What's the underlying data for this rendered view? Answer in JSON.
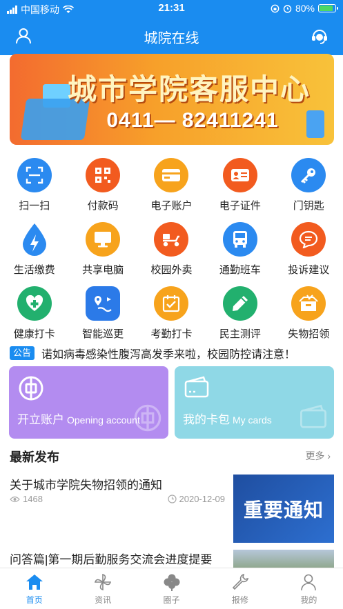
{
  "status_bar": {
    "carrier": "中国移动",
    "time": "21:31",
    "battery": "80%"
  },
  "header": {
    "title": "城院在线"
  },
  "banner": {
    "title": "城市学院客服中心",
    "phone": "0411— 82411241"
  },
  "grid": [
    [
      {
        "label": "扫一扫",
        "icon": "scan-icon",
        "color": "#2b8af0"
      },
      {
        "label": "付款码",
        "icon": "qrcode-icon",
        "color": "#f25b1f"
      },
      {
        "label": "电子账户",
        "icon": "card-icon",
        "color": "#f7a31c"
      },
      {
        "label": "电子证件",
        "icon": "id-card-icon",
        "color": "#f25b1f"
      },
      {
        "label": "门钥匙",
        "icon": "key-icon",
        "color": "#2b8af0"
      }
    ],
    [
      {
        "label": "生活缴费",
        "icon": "water-drop-icon",
        "color": "#2b8af0"
      },
      {
        "label": "共享电脑",
        "icon": "monitor-icon",
        "color": "#f7a31c"
      },
      {
        "label": "校园外卖",
        "icon": "delivery-scooter-icon",
        "color": "#f25b1f"
      },
      {
        "label": "通勤班车",
        "icon": "bus-icon",
        "color": "#2b8af0"
      },
      {
        "label": "投诉建议",
        "icon": "chat-bubble-icon",
        "color": "#f25b1f"
      }
    ],
    [
      {
        "label": "健康打卡",
        "icon": "health-plus-icon",
        "color": "#22b06e"
      },
      {
        "label": "智能巡更",
        "icon": "patrol-map-icon",
        "color": "#2b7ae8"
      },
      {
        "label": "考勤打卡",
        "icon": "calendar-check-icon",
        "color": "#f7a31c"
      },
      {
        "label": "民主测评",
        "icon": "pencil-icon",
        "color": "#22b06e"
      },
      {
        "label": "失物招领",
        "icon": "lost-found-box-icon",
        "color": "#f7a31c"
      }
    ]
  ],
  "notice": {
    "tag": "公告",
    "text": "诺如病毒感染性腹泻高发季来啦，校园防控请注意！"
  },
  "cards": [
    {
      "label": "开立账户",
      "sub": "Opening account",
      "color": "#b38cf0"
    },
    {
      "label": "我的卡包",
      "sub": "My cards",
      "color": "#8fd8e6"
    }
  ],
  "latest": {
    "title": "最新发布",
    "more": "更多 ›",
    "items": [
      {
        "title": "关于城市学院失物招领的通知",
        "views": "1468",
        "date": "2020-12-09",
        "thumb_text": "重要通知"
      },
      {
        "title": "问答篇|第一期后勤服务交流会进度提要"
      }
    ]
  },
  "tabbar": [
    {
      "label": "首页",
      "icon": "home-icon",
      "active": true
    },
    {
      "label": "资讯",
      "icon": "pinwheel-icon",
      "active": false
    },
    {
      "label": "圈子",
      "icon": "clover-icon",
      "active": false
    },
    {
      "label": "报修",
      "icon": "wrench-icon",
      "active": false
    },
    {
      "label": "我的",
      "icon": "person-icon",
      "active": false
    }
  ],
  "colors": {
    "primary": "#1a8cf0",
    "banner": "#f7a02a"
  }
}
